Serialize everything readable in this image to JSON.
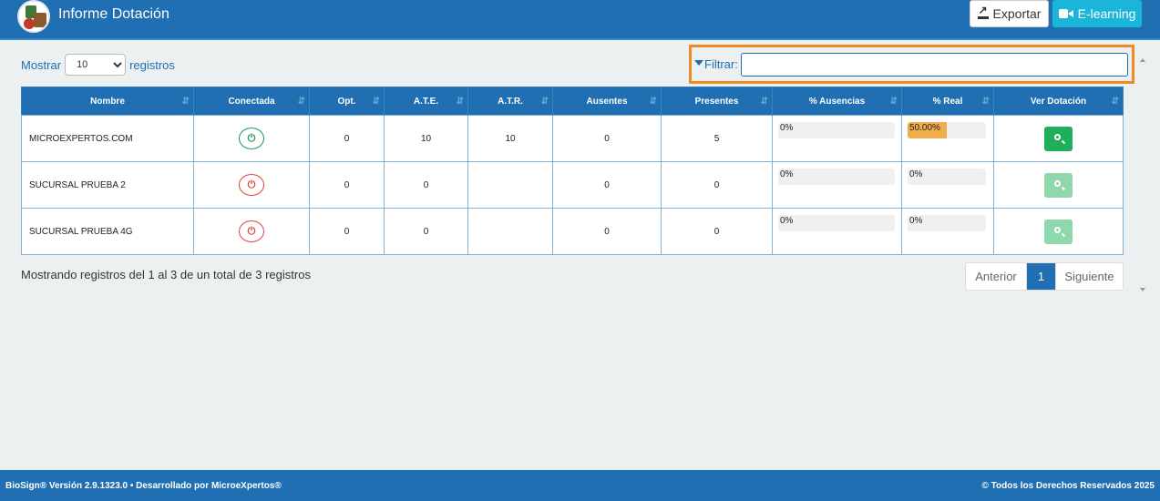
{
  "header": {
    "title": "Informe Dotación",
    "export_label": "Exportar",
    "elearning_label": "E-learning"
  },
  "length": {
    "prefix": "Mostrar",
    "value": "10",
    "suffix": "registros"
  },
  "filter": {
    "label": "Filtrar:",
    "value": ""
  },
  "table": {
    "columns": [
      "Nombre",
      "Conectada",
      "Opt.",
      "A.T.E.",
      "A.T.R.",
      "Ausentes",
      "Presentes",
      "% Ausencias",
      "% Real",
      "Ver Dotación"
    ],
    "rows": [
      {
        "nombre": "MICROEXPERTOS.COM",
        "connected": true,
        "opt": "0",
        "ate": "10",
        "atr": "10",
        "ausentes": "0",
        "presentes": "5",
        "pct_ausencias": "0%",
        "pct_real": "50.00%",
        "pct_real_fraction": 0.5,
        "ver_enabled": true
      },
      {
        "nombre": "SUCURSAL PRUEBA 2",
        "connected": false,
        "opt": "0",
        "ate": "0",
        "atr": "",
        "ausentes": "0",
        "presentes": "0",
        "pct_ausencias": "0%",
        "pct_real": "0%",
        "pct_real_fraction": 0,
        "ver_enabled": false
      },
      {
        "nombre": "SUCURSAL PRUEBA 4G",
        "connected": false,
        "opt": "0",
        "ate": "0",
        "atr": "",
        "ausentes": "0",
        "presentes": "0",
        "pct_ausencias": "0%",
        "pct_real": "0%",
        "pct_real_fraction": 0,
        "ver_enabled": false
      }
    ]
  },
  "info_text": "Mostrando registros del 1 al 3 de un total de 3 registros",
  "pagination": {
    "prev": "Anterior",
    "current": "1",
    "next": "Siguiente"
  },
  "footer": {
    "left": "BioSign® Versión 2.9.1323.0 • Desarrollado por MicroeXpertos®",
    "right": "© Todos los Derechos Reservados 2025"
  },
  "colors": {
    "primary": "#1f6fb2",
    "accent": "#f08a24",
    "success": "#1fae5b",
    "warning": "#f0ad4e",
    "danger": "#e0443a"
  },
  "icons": {
    "connected": "plug-icon",
    "view": "search-plus-icon",
    "export": "file-export-icon",
    "elearning": "video-camera-icon",
    "filter": "funnel-icon"
  }
}
